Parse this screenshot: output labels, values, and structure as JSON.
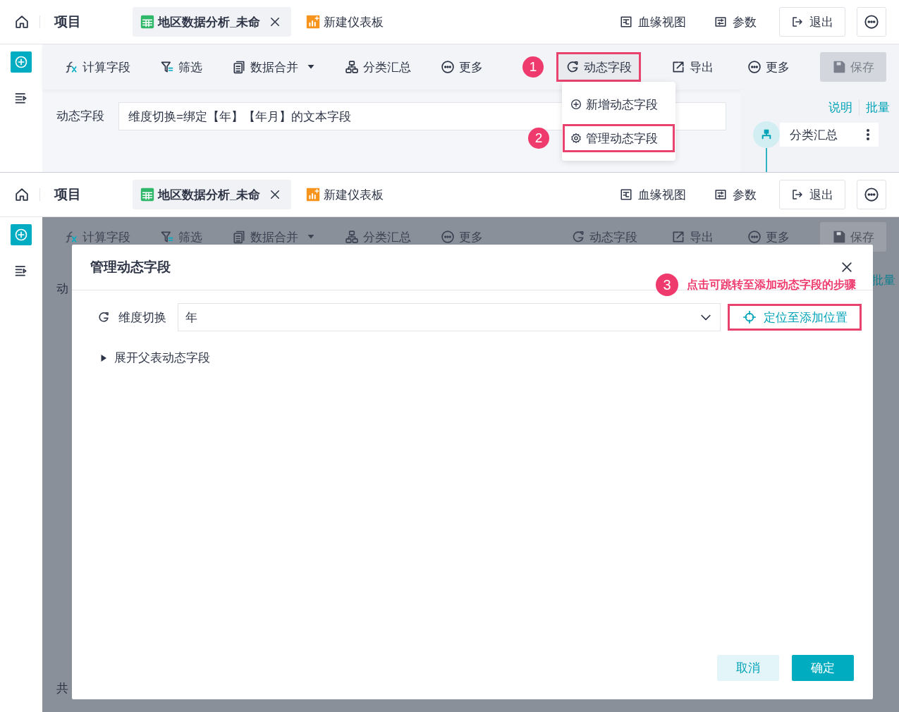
{
  "panels": [
    {
      "header": {
        "project_title": "项目",
        "tabs": [
          {
            "label": "地区数据分析_未命",
            "kind": "table",
            "selected": true,
            "closable": true
          },
          {
            "label": "新建仪表板",
            "kind": "dashboard",
            "selected": false,
            "closable": false
          }
        ],
        "actions": [
          {
            "label": "血缘视图",
            "kind": "lineage"
          },
          {
            "label": "参数",
            "kind": "params"
          },
          {
            "label": "退出",
            "kind": "exit"
          },
          {
            "kind": "more"
          }
        ]
      },
      "dimmed": false,
      "toolbar": {
        "left": [
          {
            "label": "计算字段",
            "kind": "fx"
          },
          {
            "label": "筛选",
            "kind": "filter"
          },
          {
            "label": "数据合并",
            "kind": "merge",
            "dropdown": true
          },
          {
            "label": "分类汇总",
            "kind": "group"
          },
          {
            "label": "更多",
            "kind": "more"
          }
        ],
        "right": [
          {
            "label": "动态字段",
            "kind": "dynamic",
            "highlighted": true,
            "callout": "1"
          },
          {
            "label": "导出",
            "kind": "export"
          },
          {
            "label": "更多",
            "kind": "more"
          },
          {
            "label": "保存",
            "kind": "save",
            "disabled": true
          }
        ]
      },
      "field_row": {
        "label": "动态字段",
        "value": "维度切换=绑定【年】【年月】的文本字段"
      },
      "side_panel": {
        "links": [
          "说明",
          "批量"
        ],
        "node": {
          "label": "分类汇总"
        }
      },
      "dropdown_menu": {
        "items": [
          {
            "label": "新增动态字段",
            "kind": "add",
            "highlighted": false
          },
          {
            "label": "管理动态字段",
            "kind": "gear",
            "highlighted": true,
            "callout": "2"
          }
        ]
      }
    },
    {
      "header": {
        "project_title": "项目",
        "tabs": [
          {
            "label": "地区数据分析_未命",
            "kind": "table",
            "selected": true,
            "closable": true
          },
          {
            "label": "新建仪表板",
            "kind": "dashboard",
            "selected": false,
            "closable": false
          }
        ],
        "actions": [
          {
            "label": "血缘视图",
            "kind": "lineage"
          },
          {
            "label": "参数",
            "kind": "params"
          },
          {
            "label": "退出",
            "kind": "exit"
          },
          {
            "kind": "more"
          }
        ]
      },
      "dimmed": true,
      "toolbar": {
        "left": [
          {
            "label": "计算字段",
            "kind": "fx"
          },
          {
            "label": "筛选",
            "kind": "filter"
          },
          {
            "label": "数据合并",
            "kind": "merge",
            "dropdown": true
          },
          {
            "label": "分类汇总",
            "kind": "group"
          },
          {
            "label": "更多",
            "kind": "more"
          }
        ],
        "right": [
          {
            "label": "动态字段",
            "kind": "dynamic",
            "highlighted": false
          },
          {
            "label": "导出",
            "kind": "export"
          },
          {
            "label": "更多",
            "kind": "more"
          },
          {
            "label": "保存",
            "kind": "save",
            "disabled": true
          }
        ]
      },
      "background_texts": {
        "field_label": "动",
        "side_link": "批量",
        "footer": "共"
      },
      "modal": {
        "title": "管理动态字段",
        "callout": {
          "number": "3",
          "text": "点击可跳转至添加动态字段的步骤"
        },
        "row": {
          "label": "维度切换",
          "value": "年",
          "button": {
            "label": "定位至添加位置",
            "highlighted": true
          }
        },
        "expander": {
          "label": "展开父表动态字段",
          "expanded": false
        },
        "buttons": [
          {
            "label": "取消",
            "kind": "secondary"
          },
          {
            "label": "确定",
            "kind": "primary"
          }
        ]
      }
    }
  ]
}
